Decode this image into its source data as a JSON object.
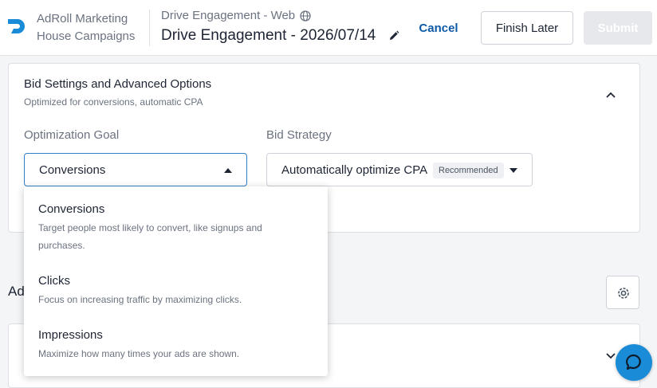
{
  "header": {
    "org_line1": "AdRoll Marketing",
    "org_line2": "House Campaigns",
    "campaign_type": "Drive Engagement - Web",
    "campaign_name": "Drive Engagement - 2026/07/14",
    "cancel_label": "Cancel",
    "finish_later_label": "Finish Later",
    "submit_label": "Submit"
  },
  "bid_settings": {
    "title": "Bid Settings and Advanced Options",
    "subtitle": "Optimized for conversions, automatic CPA",
    "goal_label": "Optimization Goal",
    "goal_value": "Conversions",
    "strategy_label": "Bid Strategy",
    "strategy_value": "Automatically optimize CPA",
    "strategy_badge": "Recommended"
  },
  "goal_options": [
    {
      "title": "Conversions",
      "desc": "Target people most likely to convert, like signups and purchases."
    },
    {
      "title": "Clicks",
      "desc": "Focus on increasing traffic by maximizing clicks."
    },
    {
      "title": "Impressions",
      "desc": "Maximize how many times your ads are shown."
    }
  ],
  "section2": {
    "title_visible": "Ad"
  },
  "colors": {
    "accent": "#0f5aa6",
    "focus_border": "#2f80c9",
    "chat": "#1a8bd6"
  }
}
